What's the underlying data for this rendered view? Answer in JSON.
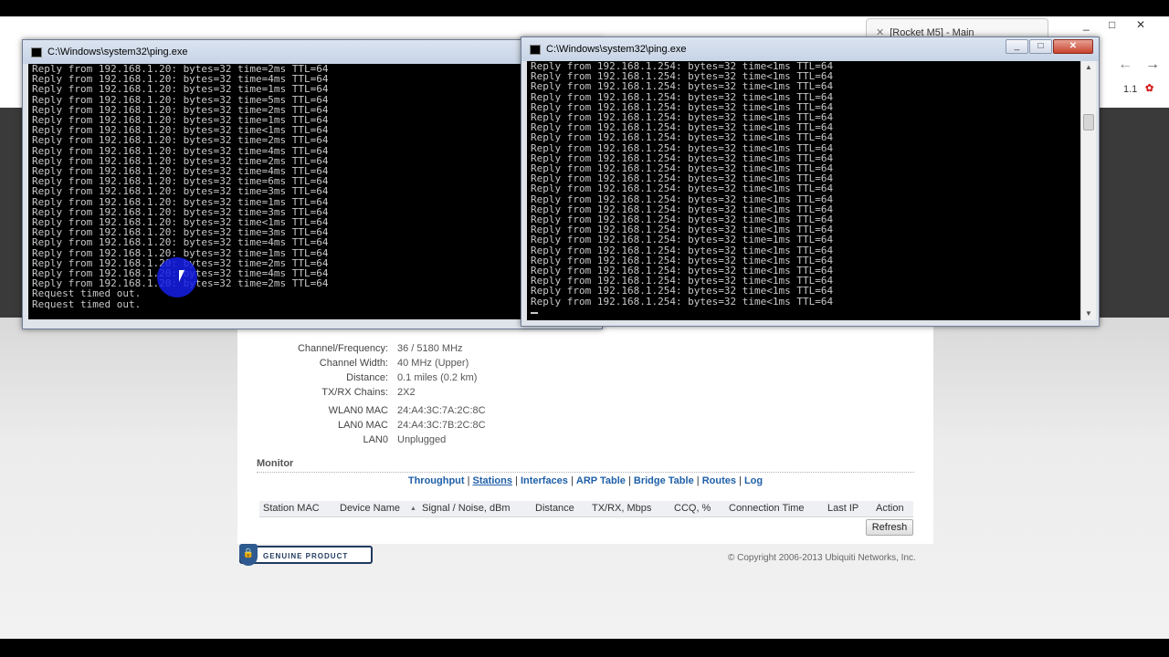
{
  "browser": {
    "tab_label": "[Rocket M5] - Main",
    "window_controls": [
      "_",
      "□",
      "✕"
    ],
    "nav": {
      "back": "←",
      "forward": "→"
    },
    "side_texts": [
      "1.1"
    ]
  },
  "ubnt": {
    "info": [
      {
        "label": "Channel/Frequency:",
        "value": "36 / 5180 MHz"
      },
      {
        "label": "Channel Width:",
        "value": "40 MHz (Upper)"
      },
      {
        "label": "Distance:",
        "value": "0.1 miles (0.2 km)"
      },
      {
        "label": "TX/RX Chains:",
        "value": "2X2"
      },
      {
        "label": "WLAN0 MAC",
        "value": "24:A4:3C:7A:2C:8C"
      },
      {
        "label": "LAN0 MAC",
        "value": "24:A4:3C:7B:2C:8C"
      },
      {
        "label": "LAN0",
        "value": "Unplugged"
      }
    ],
    "monitor_title": "Monitor",
    "links": [
      "Throughput",
      "Stations",
      "Interfaces",
      "ARP Table",
      "Bridge Table",
      "Routes",
      "Log"
    ],
    "active_link": "Stations",
    "columns": [
      "Station MAC",
      "Device Name",
      "Signal / Noise, dBm",
      "Distance",
      "TX/RX, Mbps",
      "CCQ, %",
      "Connection Time",
      "Last IP",
      "Action"
    ],
    "sort_indicator": "▲",
    "refresh_label": "Refresh",
    "genuine_text": "GENUINE PRODUCT",
    "copyright": "© Copyright 2006-2013 Ubiquiti Networks, Inc."
  },
  "console_left": {
    "title": "C:\\Windows\\system32\\ping.exe",
    "lines": [
      "Reply from 192.168.1.20: bytes=32 time=2ms TTL=64",
      "Reply from 192.168.1.20: bytes=32 time=4ms TTL=64",
      "Reply from 192.168.1.20: bytes=32 time=1ms TTL=64",
      "Reply from 192.168.1.20: bytes=32 time=5ms TTL=64",
      "Reply from 192.168.1.20: bytes=32 time=2ms TTL=64",
      "Reply from 192.168.1.20: bytes=32 time=1ms TTL=64",
      "Reply from 192.168.1.20: bytes=32 time<1ms TTL=64",
      "Reply from 192.168.1.20: bytes=32 time=2ms TTL=64",
      "Reply from 192.168.1.20: bytes=32 time=4ms TTL=64",
      "Reply from 192.168.1.20: bytes=32 time=2ms TTL=64",
      "Reply from 192.168.1.20: bytes=32 time=4ms TTL=64",
      "Reply from 192.168.1.20: bytes=32 time=6ms TTL=64",
      "Reply from 192.168.1.20: bytes=32 time=3ms TTL=64",
      "Reply from 192.168.1.20: bytes=32 time=1ms TTL=64",
      "Reply from 192.168.1.20: bytes=32 time=3ms TTL=64",
      "Reply from 192.168.1.20: bytes=32 time<1ms TTL=64",
      "Reply from 192.168.1.20: bytes=32 time=3ms TTL=64",
      "Reply from 192.168.1.20: bytes=32 time=4ms TTL=64",
      "Reply from 192.168.1.20: bytes=32 time=1ms TTL=64",
      "Reply from 192.168.1.20: bytes=32 time=2ms TTL=64",
      "Reply from 192.168.1.20: bytes=32 time=4ms TTL=64",
      "Reply from 192.168.1.20: bytes=32 time=2ms TTL=64",
      "Request timed out.",
      "Request timed out."
    ]
  },
  "console_right": {
    "title": "C:\\Windows\\system32\\ping.exe",
    "lines": [
      "Reply from 192.168.1.254: bytes=32 time<1ms TTL=64",
      "Reply from 192.168.1.254: bytes=32 time<1ms TTL=64",
      "Reply from 192.168.1.254: bytes=32 time<1ms TTL=64",
      "Reply from 192.168.1.254: bytes=32 time<1ms TTL=64",
      "Reply from 192.168.1.254: bytes=32 time<1ms TTL=64",
      "Reply from 192.168.1.254: bytes=32 time<1ms TTL=64",
      "Reply from 192.168.1.254: bytes=32 time<1ms TTL=64",
      "Reply from 192.168.1.254: bytes=32 time<1ms TTL=64",
      "Reply from 192.168.1.254: bytes=32 time<1ms TTL=64",
      "Reply from 192.168.1.254: bytes=32 time<1ms TTL=64",
      "Reply from 192.168.1.254: bytes=32 time<1ms TTL=64",
      "Reply from 192.168.1.254: bytes=32 time<1ms TTL=64",
      "Reply from 192.168.1.254: bytes=32 time<1ms TTL=64",
      "Reply from 192.168.1.254: bytes=32 time<1ms TTL=64",
      "Reply from 192.168.1.254: bytes=32 time<1ms TTL=64",
      "Reply from 192.168.1.254: bytes=32 time<1ms TTL=64",
      "Reply from 192.168.1.254: bytes=32 time<1ms TTL=64",
      "Reply from 192.168.1.254: bytes=32 time=1ms TTL=64",
      "Reply from 192.168.1.254: bytes=32 time<1ms TTL=64",
      "Reply from 192.168.1.254: bytes=32 time<1ms TTL=64",
      "Reply from 192.168.1.254: bytes=32 time<1ms TTL=64",
      "Reply from 192.168.1.254: bytes=32 time<1ms TTL=64",
      "Reply from 192.168.1.254: bytes=32 time<1ms TTL=64",
      "Reply from 192.168.1.254: bytes=32 time<1ms TTL=64"
    ]
  },
  "console_buttons": {
    "minimize": "_",
    "maximize": "□",
    "close": "✕"
  }
}
